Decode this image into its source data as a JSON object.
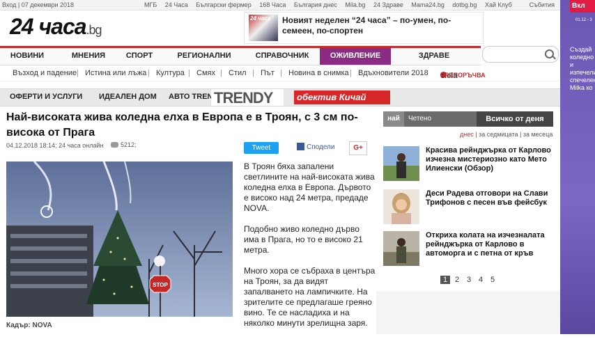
{
  "topbar": {
    "login": "Вход | 07 декември 2018",
    "sites": [
      "МГБ",
      "24 Часа",
      "Български фермер",
      "168 Часа",
      "България днес",
      "Mila.bg",
      "24 Здраве",
      "Mama24.bg",
      "dotbg.bg",
      "Хай Клуб"
    ],
    "events": "Събития"
  },
  "header": {
    "logo_main": "24 часа",
    "logo_suffix": ".bg",
    "promo_thumb": "24 часа",
    "promo_text": "Новият неделен “24 часа” – по-умен, по-семеен, по-спортен"
  },
  "mainnav": {
    "items": [
      "НОВИНИ",
      "МНЕНИЯ",
      "СПОРТ",
      "РЕГИОНАЛНИ",
      "СПРАВОЧНИК",
      "ОЖИВЛЕНИЕ",
      "ЗДРАВЕ"
    ],
    "active": "ОЖИВЛЕНИЕ"
  },
  "subnav": {
    "items": [
      "Възход и падение",
      "Истина или лъжа",
      "Култура",
      "Смях",
      "Стил",
      "Път",
      "Новина в снимка",
      "Вдъхновители 2018"
    ],
    "ciela": "ciela",
    "ciela_tag": "ПРЕПОРЪЧВА"
  },
  "secnav": {
    "items": [
      "ОФЕРТИ И УСЛУГИ",
      "ИДЕАЛЕН ДОМ",
      "АВТО TREND"
    ],
    "trendy": "TRENDY",
    "obektiv": "обектив Кичай"
  },
  "article": {
    "title": "Най-високата жива коледна елха в Европа е в Троян, с 3 см по-висока от Прага",
    "meta": "04.12.2018 18:14; 24 часа онлайн",
    "comments": "5212;",
    "tweet": "Tweet",
    "share": "Сподели",
    "gplus": "G+",
    "caption": "Кадър: NOVA",
    "paragraphs": [
      "В Троян бяха запалени светлините на най-високата жива коледна елха в Европа. Дървото е високо над 24 метра, предаде NOVA.",
      "Подобно живо коледно дърво има в Прага, но то е високо 21 метра.",
      "Много хора се събраха в центъра на Троян, за да видят запалването на лампичките. На зрителите се предлагаше греяно вино. Те се насладиха и на няколко минути зрелищна заря."
    ],
    "stop_sign": "STOP"
  },
  "sidebar": {
    "tab_most": "най",
    "tab_read": "Четено",
    "tab_all": "Всичко от деня",
    "period": [
      "днес",
      "за седмицата",
      "за месеца"
    ],
    "items": [
      {
        "title": "Красива рейнджърка от Карлово изчезна мистериозно като Мето Илиенски (Обзор)"
      },
      {
        "title": "Деси Радева отговори на Слави Трифонов с песен във фейсбук"
      },
      {
        "title": "Откриха колата на изчезналата рейнджърка от Карлово в автоморга и с петна от кръв"
      }
    ],
    "pages": [
      "1",
      "2",
      "3",
      "4",
      "5"
    ],
    "current_page": "1"
  },
  "ad": {
    "button": "Вкл",
    "date": "01.12 - 3",
    "copy": "Създай коледно и изпечели спечелени Milka ко"
  },
  "colors": {
    "brand_red": "#c52b2b",
    "active_tab": "#8a2c83",
    "twitter": "#1da1f2",
    "facebook": "#3b5998"
  }
}
